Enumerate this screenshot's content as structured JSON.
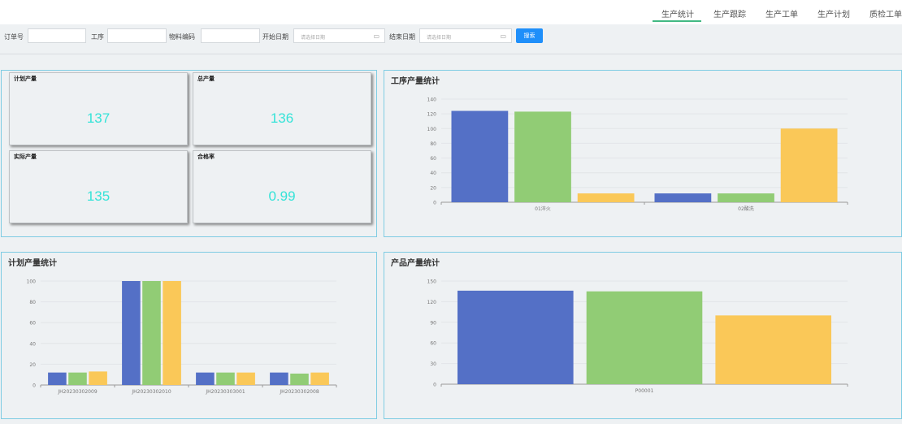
{
  "nav": {
    "tabs": [
      {
        "label": "生产统计",
        "active": true
      },
      {
        "label": "生产跟踪"
      },
      {
        "label": "生产工单"
      },
      {
        "label": "生产计划"
      },
      {
        "label": "质检工单"
      }
    ],
    "active_color": "#42b983"
  },
  "search": {
    "order_label": "订单号",
    "process_label": "工序",
    "material_label": "物料编码",
    "start_label": "开始日期",
    "start_placeholder": "请选择日期",
    "end_label": "结束日期",
    "end_placeholder": "请选择日期",
    "search_button": "搜索",
    "button_color": "#1f8ffa"
  },
  "stats": {
    "planned_label": "计划产量",
    "planned_value": "137",
    "total_label": "总产量",
    "total_value": "136",
    "actual_label": "实际产量",
    "actual_value": "135",
    "rate_label": "合格率",
    "rate_value": "0.99",
    "value_color": "#35e3d8"
  },
  "panels": {
    "process_title": "工序产量统计",
    "plan_title": "计划产量统计",
    "product_title": "产品产量统计"
  },
  "colors": {
    "series1": "#5470c6",
    "series2": "#91cc75",
    "series3": "#fac858",
    "panel_border": "#7fcce3"
  },
  "chart_data": [
    {
      "type": "bar",
      "title": "工序产量统计",
      "categories": [
        "01淬火",
        "02酸洗"
      ],
      "series": [
        {
          "values": [
            124,
            12
          ]
        },
        {
          "values": [
            123,
            12
          ]
        },
        {
          "values": [
            12,
            100
          ]
        }
      ],
      "ylim": [
        0,
        140
      ],
      "yticks": [
        0,
        20,
        40,
        60,
        80,
        100,
        120,
        140
      ],
      "grid": true
    },
    {
      "type": "bar",
      "title": "计划产量统计",
      "categories": [
        "JH20230302009",
        "JH20230302010",
        "JH20230303001",
        "JH20230302008"
      ],
      "series": [
        {
          "values": [
            12,
            100,
            12,
            12
          ]
        },
        {
          "values": [
            12,
            100,
            12,
            11
          ]
        },
        {
          "values": [
            13,
            100,
            12,
            12
          ]
        }
      ],
      "ylim": [
        0,
        100
      ],
      "yticks": [
        0,
        20,
        40,
        60,
        80,
        100
      ],
      "grid": true
    },
    {
      "type": "bar",
      "title": "产品产量统计",
      "categories": [
        "P00001"
      ],
      "series": [
        {
          "values": [
            136
          ]
        },
        {
          "values": [
            135
          ]
        },
        {
          "values": [
            100
          ]
        }
      ],
      "ylim": [
        0,
        150
      ],
      "yticks": [
        0,
        30,
        60,
        90,
        120,
        150
      ],
      "grid": true
    }
  ]
}
